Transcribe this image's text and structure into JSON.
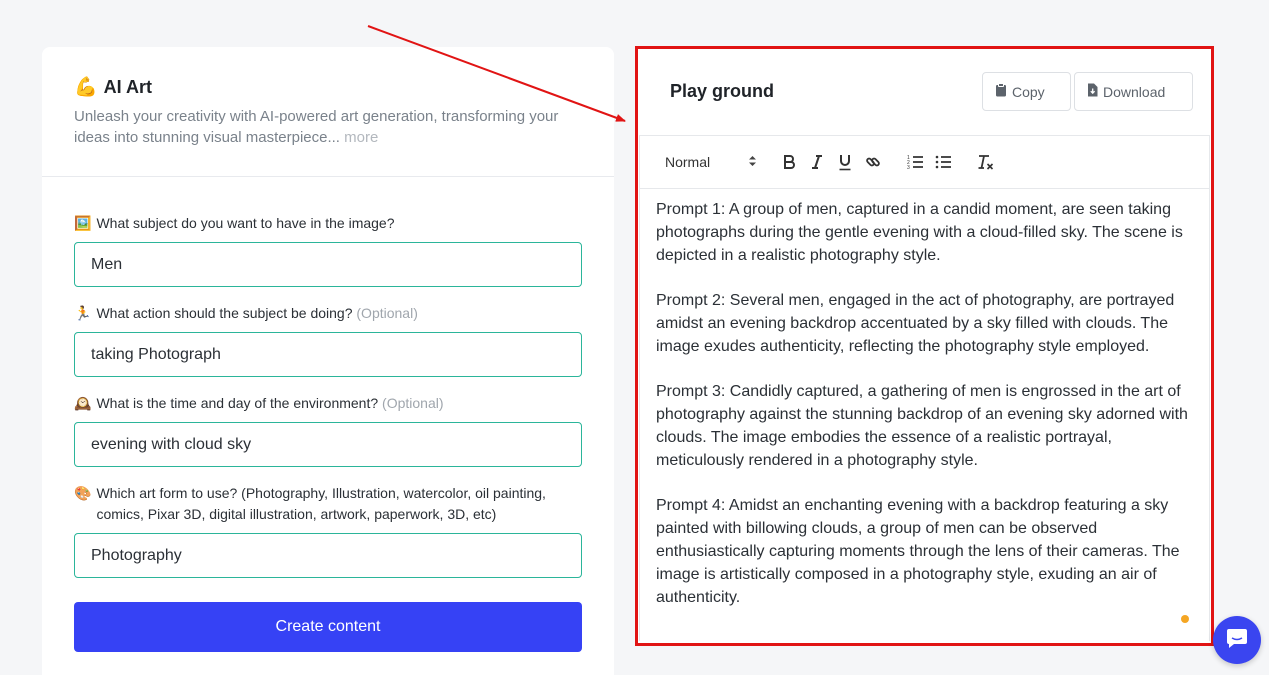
{
  "app": {
    "icon": "flexed-arm-emoji",
    "title": "AI Art",
    "description": "Unleash your creativity with AI-powered art generation, transforming your ideas into stunning visual masterpiece...",
    "more_link": " more"
  },
  "form": {
    "fields": [
      {
        "icon": "🖼️",
        "label": "What subject do you want to have in the image?",
        "optional": "",
        "value": "Men"
      },
      {
        "icon": "🏃",
        "label": "What action should the subject be doing?",
        "optional": "(Optional)",
        "value": "taking Photograph"
      },
      {
        "icon": "🕰️",
        "label": "What is the time and day of the environment?",
        "optional": "(Optional)",
        "value": "evening with cloud sky"
      },
      {
        "icon": "🎨",
        "label": "Which art form to use? (Photography, Illustration, watercolor, oil painting, comics, Pixar 3D, digital illustration, artwork, paperwork, 3D, etc)",
        "optional": "",
        "value": "Photography"
      }
    ],
    "submit_label": "Create content"
  },
  "playground": {
    "title": "Play ground",
    "copy_label": "Copy",
    "download_label": "Download",
    "format_select": "Normal",
    "toolbar_icons": [
      "bold-icon",
      "italic-icon",
      "underline-icon",
      "link-icon",
      "ordered-list-icon",
      "bullet-list-icon",
      "clear-format-icon"
    ],
    "paragraphs": [
      "Prompt 1: A group of men, captured in a candid moment, are seen taking photographs during the gentle evening with a cloud-filled sky. The scene is depicted in a realistic photography style.",
      "Prompt 2: Several men, engaged in the act of photography, are portrayed amidst an evening backdrop accentuated by a sky filled with clouds. The image exudes authenticity, reflecting the photography style employed.",
      "Prompt 3: Candidly captured, a gathering of men is engrossed in the art of photography against the stunning backdrop of an evening sky adorned with clouds. The image embodies the essence of a realistic portrayal, meticulously rendered in a photography style.",
      "Prompt 4: Amidst an enchanting evening with a backdrop featuring a sky painted with billowing clouds, a group of men can be observed enthusiastically capturing moments through the lens of their cameras. The image is artistically composed in a photography style, exuding an air of authenticity."
    ]
  },
  "colors": {
    "accent": "#3642f5",
    "input_border": "#2bb59a",
    "highlight": "#e11414",
    "chat": "#3a45f0"
  }
}
